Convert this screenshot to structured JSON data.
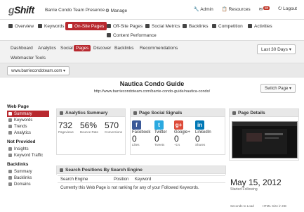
{
  "topbar": {
    "logo_g": "g",
    "logo_rest": "Shift",
    "org": "Barrie Condo Team Presence",
    "manage": "Manage",
    "admin": "Admin",
    "resources": "Resources",
    "notif_count": "80",
    "logout": "Logout"
  },
  "mainnav": {
    "overview": "Overview",
    "keywords": "Keywords",
    "onsite": "On-Site Pages",
    "offsite": "Off-Site Pages",
    "social": "Social Metrics",
    "backlinks": "Backlinks",
    "competition": "Competition",
    "activities": "Activities",
    "content": "Content Performance"
  },
  "subnav": {
    "tabs": [
      "Dashboard",
      "Analytics",
      "Social",
      "Pages",
      "Discover",
      "Backlinks",
      "Recommendations"
    ],
    "webmaster": "Webmaster Tools",
    "range": "Last 30 Days"
  },
  "urlbar": {
    "site": "www.barriecondoteam.com"
  },
  "page": {
    "title": "Nautica Condo Guide",
    "url": "http://www.barriecondoteam.com/barrie-condo-guide/nautica-condo/",
    "switch": "Switch Page"
  },
  "sidebar": {
    "h1": "Web Page",
    "i1": "Summary",
    "i2": "Keywords",
    "i3": "Trends",
    "i4": "Analytics",
    "h2": "Not Provided",
    "i5": "Insights",
    "i6": "Keyword Traffic",
    "h3": "Backlinks",
    "i7": "Summary",
    "i8": "Backlinks",
    "i9": "Domains"
  },
  "analytics": {
    "title": "Analytics Summary",
    "pageviews": "732",
    "pageviews_lbl": "Pageviews",
    "bounce": "56%",
    "bounce_lbl": "Bounce Rate",
    "conversions": "570",
    "conversions_lbl": "Conversions"
  },
  "social": {
    "title": "Page Social Signals",
    "facebook": "Facebook",
    "fb_val": "0",
    "fb_sub": "Likes",
    "twitter": "Twitter",
    "tw_val": "0",
    "tw_sub": "Tweets",
    "google": "Google+",
    "g_val": "0",
    "g_sub": "+1's",
    "linkedin": "LinkedIn",
    "li_val": "0",
    "li_sub": "Shares"
  },
  "details": {
    "title": "Page Details",
    "date": "May 15, 2012",
    "started": "Started Following",
    "seconds": "Seconds to Load",
    "size": "HTML Size in KB"
  },
  "positions": {
    "title": "Search Positions By Search Engine",
    "col1": "Search Engine",
    "col2": "Position",
    "col3": "Keyword",
    "message": "Currently this Web Page is not ranking for any of your Followed Keywords."
  },
  "colors": {
    "accent": "#b8292f",
    "facebook": "#3b5998",
    "twitter": "#2aa9e0",
    "google": "#dd4b39",
    "linkedin": "#0077b5"
  }
}
